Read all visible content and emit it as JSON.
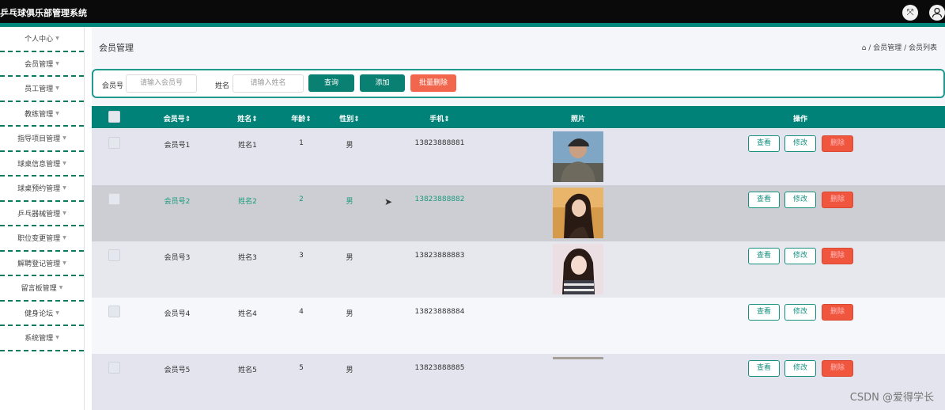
{
  "app": {
    "title": "乒乓球俱乐部管理系统",
    "fullscreen_icon": "fullscreen-icon",
    "user_icon": "user-icon"
  },
  "sidebar": {
    "items": [
      {
        "label": "个人中心"
      },
      {
        "label": "会员管理"
      },
      {
        "label": "员工管理"
      },
      {
        "label": "教练管理"
      },
      {
        "label": "指导项目管理"
      },
      {
        "label": "球桌信息管理"
      },
      {
        "label": "球桌预约管理"
      },
      {
        "label": "乒乓器械管理"
      },
      {
        "label": "职位变更管理"
      },
      {
        "label": "解聘登记管理"
      },
      {
        "label": "留言板管理"
      },
      {
        "label": "健身论坛"
      },
      {
        "label": "系统管理"
      }
    ]
  },
  "page": {
    "title": "会员管理",
    "breadcrumb": {
      "home_icon": "home-icon",
      "sep": "/",
      "level1": "会员管理",
      "level2": "会员列表"
    }
  },
  "search": {
    "member_no_label": "会员号",
    "member_no_placeholder": "请输入会员号",
    "name_label": "姓名",
    "name_placeholder": "请输入姓名",
    "query_btn": "查询",
    "add_btn": "添加",
    "batch_delete_btn": "批量删除"
  },
  "table": {
    "headers": {
      "member_no": "会员号",
      "name": "姓名",
      "age": "年龄",
      "gender": "性别",
      "phone": "手机",
      "photo": "照片",
      "actions": "操作"
    },
    "sort_glyph": "⇕",
    "actions": {
      "view": "查看",
      "edit": "修改",
      "delete": "删除"
    },
    "rows": [
      {
        "member_no": "会员号1",
        "name": "姓名1",
        "age": "1",
        "gender": "男",
        "phone": "13823888881",
        "photo": "photo-man-cap"
      },
      {
        "member_no": "会员号2",
        "name": "姓名2",
        "age": "2",
        "gender": "男",
        "phone": "13823888882",
        "photo": "photo-woman-sunset"
      },
      {
        "member_no": "会员号3",
        "name": "姓名3",
        "age": "3",
        "gender": "男",
        "phone": "13823888883",
        "photo": "photo-woman-stripes"
      },
      {
        "member_no": "会员号4",
        "name": "姓名4",
        "age": "4",
        "gender": "男",
        "phone": "13823888884",
        "photo": ""
      },
      {
        "member_no": "会员号5",
        "name": "姓名5",
        "age": "5",
        "gender": "男",
        "phone": "13823888885",
        "photo": "photo-partial"
      }
    ]
  },
  "colors": {
    "accent": "#00857a",
    "teal_button": "#0a8072",
    "red_button": "#f2664d",
    "hover_row_text": "#1a9a7e"
  },
  "watermark": "CSDN @爱得学长"
}
